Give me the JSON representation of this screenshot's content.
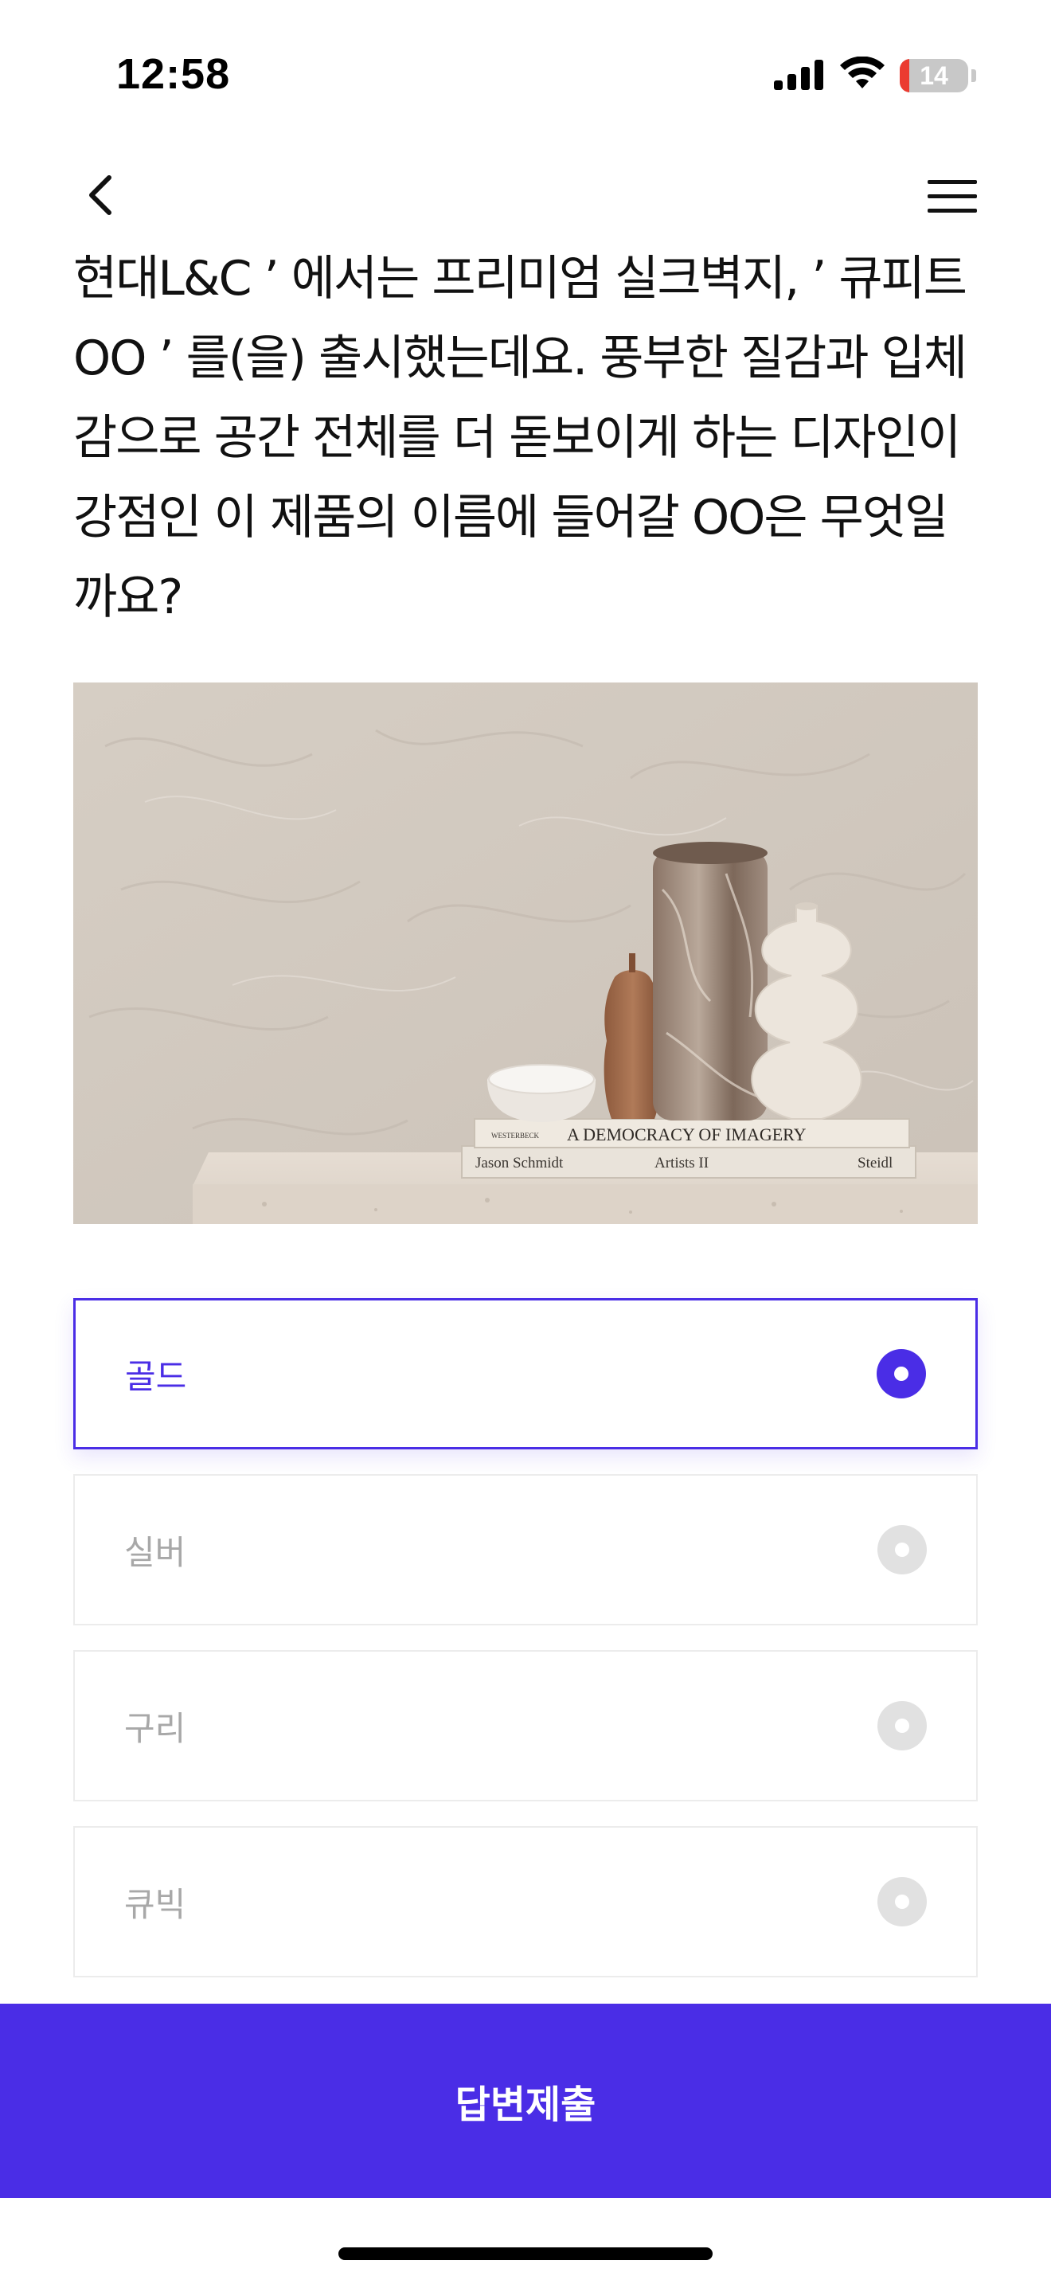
{
  "status_bar": {
    "time": "12:58",
    "battery_level": "14",
    "signal_icon": "cellular-signal-icon",
    "wifi_icon": "wifi-icon"
  },
  "nav": {
    "back_icon": "chevron-left-icon",
    "menu_icon": "hamburger-menu-icon"
  },
  "question": {
    "text": "현대L&C ’ 에서는 프리미엄 실크벽지, ’ 큐피트OO ’ 를(을) 출시했는데요. 풍부한 질감과 입체감으로 공간 전체를 더 돋보이게 하는 디자인이 강점인 이 제품의 이름에 들어갈 OO은 무엇일까요?"
  },
  "image": {
    "books": {
      "top_title": "A DEMOCRACY OF IMAGERY",
      "top_publisher": "WESTERBECK",
      "bottom_author": "Jason Schmidt",
      "bottom_title": "Artists II",
      "bottom_publisher": "Steidl"
    }
  },
  "options": [
    {
      "label": "골드",
      "selected": true
    },
    {
      "label": "실버",
      "selected": false
    },
    {
      "label": "구리",
      "selected": false
    },
    {
      "label": "큐빅",
      "selected": false
    }
  ],
  "submit": {
    "label": "답변제출"
  },
  "colors": {
    "accent": "#4a2de6",
    "option_border": "#ececec",
    "radio_inactive": "#e1e1e1",
    "option_text_inactive": "#a8a8a8",
    "battery_low": "#eb3b30"
  }
}
